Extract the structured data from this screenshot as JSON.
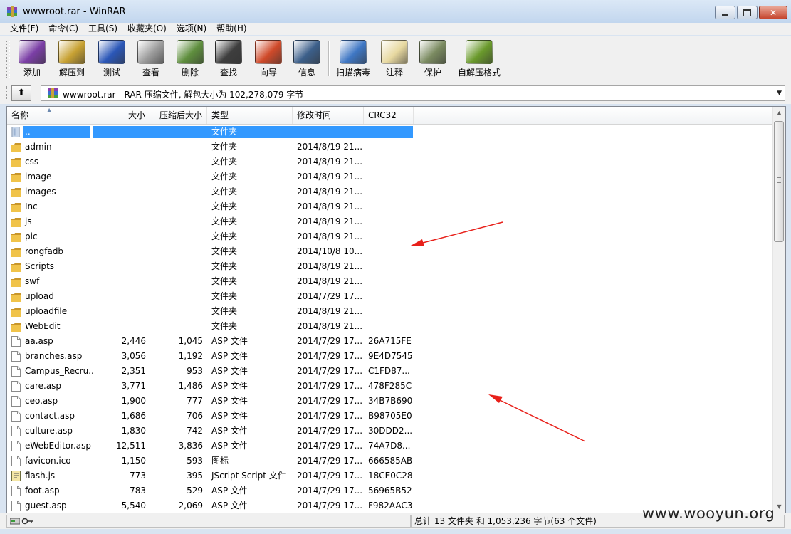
{
  "window": {
    "title": "wwwroot.rar - WinRAR",
    "controls": {
      "minimize": "",
      "maximize": "",
      "close": "✕"
    }
  },
  "menu": [
    "文件(F)",
    "命令(C)",
    "工具(S)",
    "收藏夹(O)",
    "选项(N)",
    "帮助(H)"
  ],
  "toolbar": [
    {
      "label": "添加",
      "icon": "add-books-icon",
      "color": "#7b3fa6"
    },
    {
      "label": "解压到",
      "icon": "extract-folder-icon",
      "color": "#c8a233"
    },
    {
      "label": "测试",
      "icon": "test-check-icon",
      "color": "#2b57b8"
    },
    {
      "label": "查看",
      "icon": "view-glasses-icon",
      "color": "#9b9b9b"
    },
    {
      "label": "删除",
      "icon": "delete-bin-icon",
      "color": "#5f8f3e"
    },
    {
      "label": "查找",
      "icon": "find-binoculars-icon",
      "color": "#3e3e3e"
    },
    {
      "label": "向导",
      "icon": "wizard-icon",
      "color": "#d04a2a"
    },
    {
      "label": "信息",
      "icon": "info-icon",
      "color": "#3c5f8a"
    },
    {
      "label": "扫描病毒",
      "icon": "virus-scan-icon",
      "color": "#3f77c4"
    },
    {
      "label": "注释",
      "icon": "comment-pencil-icon",
      "color": "#e7d8a0"
    },
    {
      "label": "保护",
      "icon": "protect-shield-icon",
      "color": "#7a8a60"
    },
    {
      "label": "自解压格式",
      "icon": "sfx-archive-icon",
      "color": "#6a9a2c"
    }
  ],
  "address": {
    "up": "⬆",
    "path": "wwwroot.rar - RAR 压缩文件, 解包大小为 102,278,079 字节"
  },
  "columns": {
    "name": "名称",
    "size": "大小",
    "packed": "压缩后大小",
    "type": "类型",
    "modified": "修改时间",
    "crc": "CRC32"
  },
  "rows": [
    {
      "name": "..",
      "size": "",
      "packed": "",
      "type": "文件夹",
      "modified": "",
      "crc": "",
      "kind": "up",
      "selected": true
    },
    {
      "name": "admin",
      "size": "",
      "packed": "",
      "type": "文件夹",
      "modified": "2014/8/19 21...",
      "crc": "",
      "kind": "folder"
    },
    {
      "name": "css",
      "size": "",
      "packed": "",
      "type": "文件夹",
      "modified": "2014/8/19 21...",
      "crc": "",
      "kind": "folder"
    },
    {
      "name": "image",
      "size": "",
      "packed": "",
      "type": "文件夹",
      "modified": "2014/8/19 21...",
      "crc": "",
      "kind": "folder"
    },
    {
      "name": "images",
      "size": "",
      "packed": "",
      "type": "文件夹",
      "modified": "2014/8/19 21...",
      "crc": "",
      "kind": "folder"
    },
    {
      "name": "Inc",
      "size": "",
      "packed": "",
      "type": "文件夹",
      "modified": "2014/8/19 21...",
      "crc": "",
      "kind": "folder"
    },
    {
      "name": "js",
      "size": "",
      "packed": "",
      "type": "文件夹",
      "modified": "2014/8/19 21...",
      "crc": "",
      "kind": "folder"
    },
    {
      "name": "pic",
      "size": "",
      "packed": "",
      "type": "文件夹",
      "modified": "2014/8/19 21...",
      "crc": "",
      "kind": "folder"
    },
    {
      "name": "rongfadb",
      "size": "",
      "packed": "",
      "type": "文件夹",
      "modified": "2014/10/8 10...",
      "crc": "",
      "kind": "folder"
    },
    {
      "name": "Scripts",
      "size": "",
      "packed": "",
      "type": "文件夹",
      "modified": "2014/8/19 21...",
      "crc": "",
      "kind": "folder"
    },
    {
      "name": "swf",
      "size": "",
      "packed": "",
      "type": "文件夹",
      "modified": "2014/8/19 21...",
      "crc": "",
      "kind": "folder"
    },
    {
      "name": "upload",
      "size": "",
      "packed": "",
      "type": "文件夹",
      "modified": "2014/7/29 17...",
      "crc": "",
      "kind": "folder"
    },
    {
      "name": "uploadfile",
      "size": "",
      "packed": "",
      "type": "文件夹",
      "modified": "2014/8/19 21...",
      "crc": "",
      "kind": "folder"
    },
    {
      "name": "WebEdit",
      "size": "",
      "packed": "",
      "type": "文件夹",
      "modified": "2014/8/19 21...",
      "crc": "",
      "kind": "folder"
    },
    {
      "name": "aa.asp",
      "size": "2,446",
      "packed": "1,045",
      "type": "ASP 文件",
      "modified": "2014/7/29 17...",
      "crc": "26A715FE",
      "kind": "file"
    },
    {
      "name": "branches.asp",
      "size": "3,056",
      "packed": "1,192",
      "type": "ASP 文件",
      "modified": "2014/7/29 17...",
      "crc": "9E4D7545",
      "kind": "file"
    },
    {
      "name": "Campus_Recru...",
      "size": "2,351",
      "packed": "953",
      "type": "ASP 文件",
      "modified": "2014/7/29 17...",
      "crc": "C1FD87...",
      "kind": "file"
    },
    {
      "name": "care.asp",
      "size": "3,771",
      "packed": "1,486",
      "type": "ASP 文件",
      "modified": "2014/7/29 17...",
      "crc": "478F285C",
      "kind": "file"
    },
    {
      "name": "ceo.asp",
      "size": "1,900",
      "packed": "777",
      "type": "ASP 文件",
      "modified": "2014/7/29 17...",
      "crc": "34B7B690",
      "kind": "file"
    },
    {
      "name": "contact.asp",
      "size": "1,686",
      "packed": "706",
      "type": "ASP 文件",
      "modified": "2014/7/29 17...",
      "crc": "B98705E0",
      "kind": "file"
    },
    {
      "name": "culture.asp",
      "size": "1,830",
      "packed": "742",
      "type": "ASP 文件",
      "modified": "2014/7/29 17...",
      "crc": "30DDD2...",
      "kind": "file"
    },
    {
      "name": "eWebEditor.asp",
      "size": "12,511",
      "packed": "3,836",
      "type": "ASP 文件",
      "modified": "2014/7/29 17...",
      "crc": "74A7D8...",
      "kind": "file"
    },
    {
      "name": "favicon.ico",
      "size": "1,150",
      "packed": "593",
      "type": "图标",
      "modified": "2014/7/29 17...",
      "crc": "666585AB",
      "kind": "file"
    },
    {
      "name": "flash.js",
      "size": "773",
      "packed": "395",
      "type": "JScript Script 文件",
      "modified": "2014/7/29 17...",
      "crc": "18CE0C28",
      "kind": "script"
    },
    {
      "name": "foot.asp",
      "size": "783",
      "packed": "529",
      "type": "ASP 文件",
      "modified": "2014/7/29 17...",
      "crc": "56965B52",
      "kind": "file"
    },
    {
      "name": "guest.asp",
      "size": "5,540",
      "packed": "2,069",
      "type": "ASP 文件",
      "modified": "2014/7/29 17...",
      "crc": "F982AAC3",
      "kind": "file"
    }
  ],
  "status": {
    "summary": "总计 13 文件夹 和 1,053,236 字节(63 个文件)"
  },
  "watermark": "www.wooyun.org",
  "colors": {
    "selection": "#3399ff",
    "arrow": "#e8201a",
    "folder": "#e8b93c"
  }
}
